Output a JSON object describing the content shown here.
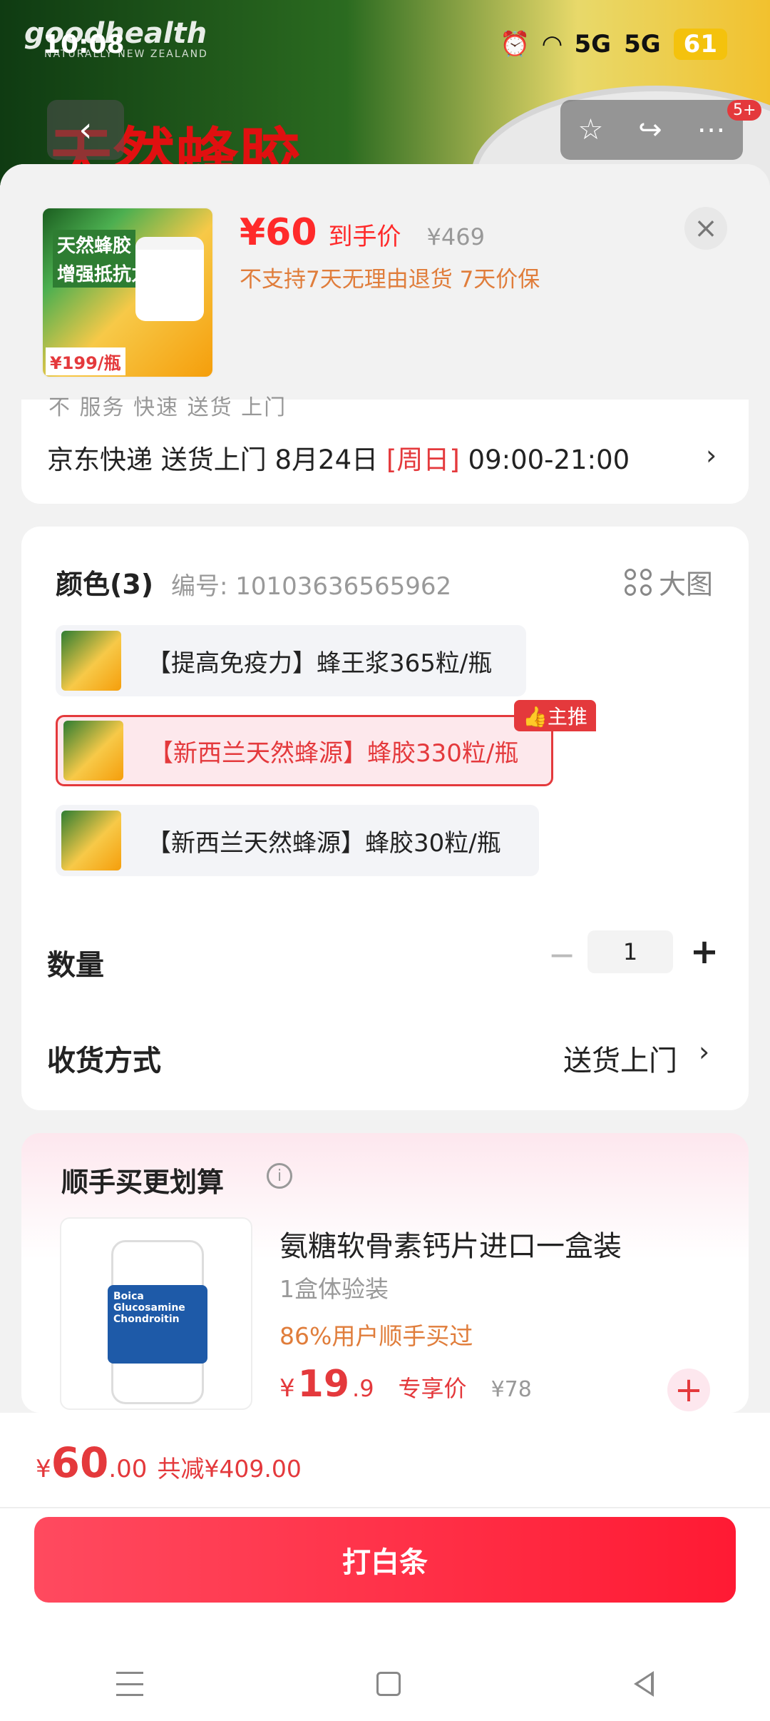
{
  "status_bar": {
    "time": "10:08",
    "signal1": "5G",
    "signal2": "5G",
    "battery": "61"
  },
  "backdrop": {
    "logo": "goodhealth",
    "logo_sub": "NATURALLY NEW ZEALAND",
    "title": "天然蜂胶",
    "badge": "5+"
  },
  "header": {
    "price": "¥60",
    "price_label": "到手价",
    "original_price": "¥469",
    "note": "不支持7天无理由退货  7天价保",
    "thumb_text1": "天然蜂胶",
    "thumb_text2": "增强抵抗力",
    "thumb_price": "¥199/瓶"
  },
  "delivery": {
    "cut_text": "不 服务 快速 送货 上门",
    "prefix": "京东快递 送货上门 8月24日 ",
    "day": "[周日]",
    "time": " 09:00-21:00"
  },
  "spec": {
    "title": "颜色(3)",
    "code": "编号: 10103636565962",
    "big_view": "大图",
    "options": [
      {
        "label": "【提高免疫力】蜂王浆365粒/瓶",
        "selected": false
      },
      {
        "label": "【新西兰天然蜂源】蜂胶330粒/瓶",
        "selected": true,
        "tag": "主推"
      },
      {
        "label": "【新西兰天然蜂源】蜂胶30粒/瓶",
        "selected": false
      }
    ],
    "quantity_label": "数量",
    "quantity": "1",
    "shipping_label": "收货方式",
    "shipping_value": "送货上门"
  },
  "upsell": {
    "title": "顺手买更划算",
    "name": "氨糖软骨素钙片进口一盒装",
    "spec": "1盒体验装",
    "buy_rate": "86%用户顺手买过",
    "price_symbol": "¥",
    "price_int": "19",
    "price_dec": ".9",
    "price_label": "专享价",
    "original_price": "¥78",
    "bottle_brand": "Boica",
    "bottle_text": "Glucosamine Chondroitin"
  },
  "bottom": {
    "symbol": "¥",
    "total_int": "60",
    "total_dec": ".00",
    "saving": "共减¥409.00",
    "pay_button": "打白条"
  },
  "colors": {
    "accent": "#e4393c",
    "orange": "#e07d3b",
    "pay": "#ff1a33"
  }
}
